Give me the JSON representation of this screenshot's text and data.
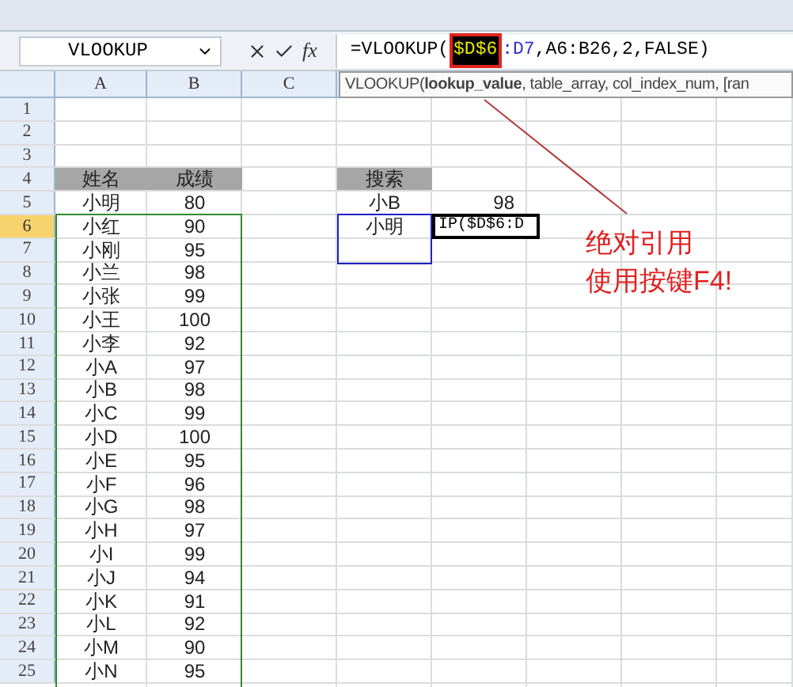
{
  "formula_bar": {
    "name_box": "VLOOKUP",
    "fx_label": "fx",
    "formula": [
      {
        "text": "=VLOOKUP(",
        "kind": "plain"
      },
      {
        "text": "$D$6",
        "kind": "highlight"
      },
      {
        "text": ":D7",
        "kind": "ref"
      },
      {
        "text": ",A6:B26,2,FALSE)",
        "kind": "plain"
      }
    ]
  },
  "tooltip": "VLOOKUP(**lookup_value**, table_array, col_index_num, [ran",
  "columns": [
    {
      "label": "A"
    },
    {
      "label": "B"
    },
    {
      "label": "C"
    }
  ],
  "rows": [
    {
      "header": "1",
      "selected": false,
      "cells": {}
    },
    {
      "header": "2",
      "selected": false,
      "cells": {}
    },
    {
      "header": "3",
      "selected": false,
      "cells": {}
    },
    {
      "header": "4",
      "selected": false,
      "cells": {
        "A": {
          "text": "姓名",
          "kind": "header"
        },
        "B": {
          "text": "成绩",
          "kind": "header"
        },
        "D": {
          "text": "搜索",
          "kind": "header"
        }
      }
    },
    {
      "header": "5",
      "selected": false,
      "cells": {
        "A": {
          "text": "小明",
          "kind": "text"
        },
        "B": {
          "text": "80",
          "kind": "text"
        },
        "D": {
          "text": "小B",
          "kind": "text"
        },
        "E": {
          "text": "98",
          "kind": "value"
        }
      }
    },
    {
      "header": "6",
      "selected": true,
      "cells": {
        "A": {
          "text": "小红",
          "kind": "text"
        },
        "B": {
          "text": "90",
          "kind": "text"
        },
        "D": {
          "text": "小明",
          "kind": "text"
        },
        "E": {
          "text": "IP($D$6:D",
          "kind": "editing"
        }
      }
    },
    {
      "header": "7",
      "selected": false,
      "cells": {
        "A": {
          "text": "小刚",
          "kind": "text"
        },
        "B": {
          "text": "95",
          "kind": "text"
        }
      }
    },
    {
      "header": "8",
      "selected": false,
      "cells": {
        "A": {
          "text": "小兰",
          "kind": "text"
        },
        "B": {
          "text": "98",
          "kind": "text"
        }
      }
    },
    {
      "header": "9",
      "selected": false,
      "cells": {
        "A": {
          "text": "小张",
          "kind": "text"
        },
        "B": {
          "text": "99",
          "kind": "text"
        }
      }
    },
    {
      "header": "10",
      "selected": false,
      "cells": {
        "A": {
          "text": "小王",
          "kind": "text"
        },
        "B": {
          "text": "100",
          "kind": "text"
        }
      }
    },
    {
      "header": "11",
      "selected": false,
      "cells": {
        "A": {
          "text": "小李",
          "kind": "text"
        },
        "B": {
          "text": "92",
          "kind": "text"
        }
      }
    },
    {
      "header": "12",
      "selected": false,
      "cells": {
        "A": {
          "text": "小A",
          "kind": "text"
        },
        "B": {
          "text": "97",
          "kind": "text"
        }
      }
    },
    {
      "header": "13",
      "selected": false,
      "cells": {
        "A": {
          "text": "小B",
          "kind": "text"
        },
        "B": {
          "text": "98",
          "kind": "text"
        }
      }
    },
    {
      "header": "14",
      "selected": false,
      "cells": {
        "A": {
          "text": "小C",
          "kind": "text"
        },
        "B": {
          "text": "99",
          "kind": "text"
        }
      }
    },
    {
      "header": "15",
      "selected": false,
      "cells": {
        "A": {
          "text": "小D",
          "kind": "text"
        },
        "B": {
          "text": "100",
          "kind": "text"
        }
      }
    },
    {
      "header": "16",
      "selected": false,
      "cells": {
        "A": {
          "text": "小E",
          "kind": "text"
        },
        "B": {
          "text": "95",
          "kind": "text"
        }
      }
    },
    {
      "header": "17",
      "selected": false,
      "cells": {
        "A": {
          "text": "小F",
          "kind": "text"
        },
        "B": {
          "text": "96",
          "kind": "text"
        }
      }
    },
    {
      "header": "18",
      "selected": false,
      "cells": {
        "A": {
          "text": "小G",
          "kind": "text"
        },
        "B": {
          "text": "98",
          "kind": "text"
        }
      }
    },
    {
      "header": "19",
      "selected": false,
      "cells": {
        "A": {
          "text": "小H",
          "kind": "text"
        },
        "B": {
          "text": "97",
          "kind": "text"
        }
      }
    },
    {
      "header": "20",
      "selected": false,
      "cells": {
        "A": {
          "text": "小I",
          "kind": "text"
        },
        "B": {
          "text": "99",
          "kind": "text"
        }
      }
    },
    {
      "header": "21",
      "selected": false,
      "cells": {
        "A": {
          "text": "小J",
          "kind": "text"
        },
        "B": {
          "text": "94",
          "kind": "text"
        }
      }
    },
    {
      "header": "22",
      "selected": false,
      "cells": {
        "A": {
          "text": "小K",
          "kind": "text"
        },
        "B": {
          "text": "91",
          "kind": "text"
        }
      }
    },
    {
      "header": "23",
      "selected": false,
      "cells": {
        "A": {
          "text": "小L",
          "kind": "text"
        },
        "B": {
          "text": "92",
          "kind": "text"
        }
      }
    },
    {
      "header": "24",
      "selected": false,
      "cells": {
        "A": {
          "text": "小M",
          "kind": "text"
        },
        "B": {
          "text": "90",
          "kind": "text"
        }
      }
    },
    {
      "header": "25",
      "selected": false,
      "cells": {
        "A": {
          "text": "小N",
          "kind": "text"
        },
        "B": {
          "text": "95",
          "kind": "text"
        }
      }
    }
  ],
  "annotation": {
    "lines": [
      "绝对引用",
      "使用按键F4!"
    ]
  }
}
